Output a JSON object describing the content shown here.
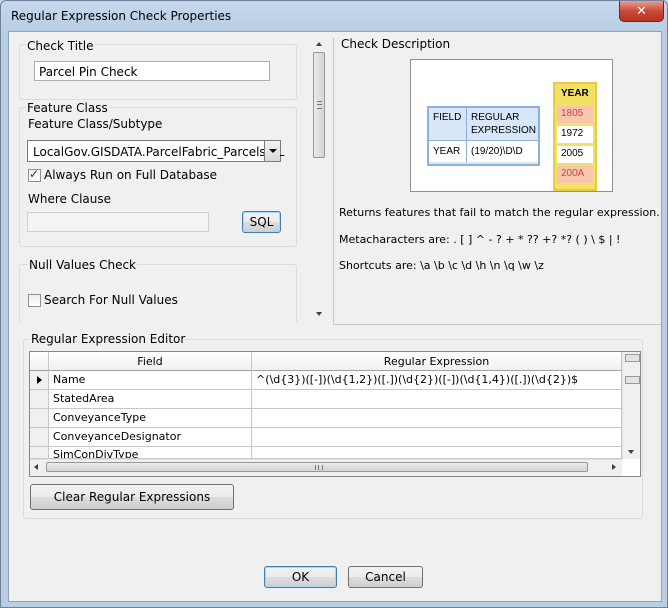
{
  "window": {
    "title": "Regular Expression Check Properties"
  },
  "check_title": {
    "group_label": "Check Title",
    "value": "Parcel Pin Check"
  },
  "feature_class": {
    "group_label": "Feature Class",
    "subtype_label": "Feature Class/Subtype",
    "selected_value": "LocalGov.GISDATA.ParcelFabric_Parcels - L",
    "always_run_label": "Always Run on Full Database",
    "where_clause_label": "Where Clause",
    "where_clause_value": "",
    "sql_button": "SQL"
  },
  "null_values": {
    "group_label": "Null Values Check",
    "checkbox_label": "Search For Null Values"
  },
  "check_description": {
    "group_label": "Check Description",
    "illustration": {
      "field_header": "FIELD",
      "regex_header": "REGULAR EXPRESSION",
      "field_value": "YEAR",
      "regex_value": "(19/20)\\D\\D",
      "year_header": "YEAR",
      "years": [
        "1805",
        "1972",
        "2005",
        "200A"
      ]
    },
    "line1": "Returns features that fail to match the regular expression.",
    "line2": "Metacharacters are: . [ ] ^ - ? + * ?? +? *? ( ) \\ $ | !",
    "line3": "Shortcuts are: \\a \\b \\c \\d \\h \\n \\q \\w \\z"
  },
  "regex_editor": {
    "group_label": "Regular Expression Editor",
    "columns": [
      "Field",
      "Regular Expression"
    ],
    "rows": [
      {
        "field": "Name",
        "expression": "^(\\d{3})([-])(\\d{1,2})([.])(\\d{2})([-])(\\d{1,4})([.])(\\d{2})$"
      },
      {
        "field": "StatedArea",
        "expression": ""
      },
      {
        "field": "ConveyanceType",
        "expression": ""
      },
      {
        "field": "ConveyanceDesignator",
        "expression": ""
      },
      {
        "field": "SimConDivType",
        "expression": ""
      }
    ],
    "clear_button": "Clear Regular Expressions"
  },
  "footer": {
    "ok_button": "OK",
    "cancel_button": "Cancel"
  }
}
